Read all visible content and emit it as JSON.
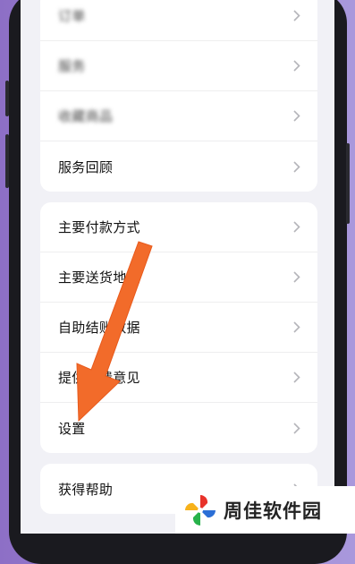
{
  "groups": [
    {
      "items": [
        {
          "label": "订单",
          "blurred": true
        },
        {
          "label": "服务",
          "blurred": true
        },
        {
          "label": "收藏商品",
          "blurred": true
        },
        {
          "label": "服务回顾",
          "blurred": false
        }
      ]
    },
    {
      "items": [
        {
          "label": "主要付款方式"
        },
        {
          "label": "主要送货地址"
        },
        {
          "label": "自助结账数据"
        },
        {
          "label": "提供反馈意见"
        },
        {
          "label": "设置"
        }
      ]
    },
    {
      "items": [
        {
          "label": "获得帮助"
        }
      ]
    }
  ],
  "annotation": {
    "arrow_color": "#f26b2a",
    "target": "设置"
  },
  "watermark": {
    "text": "周佳软件园",
    "logo_icon": "pinwheel-logo"
  },
  "colors": {
    "background_purple": "#9b86d2",
    "screen_bg": "#f1f1f6"
  }
}
